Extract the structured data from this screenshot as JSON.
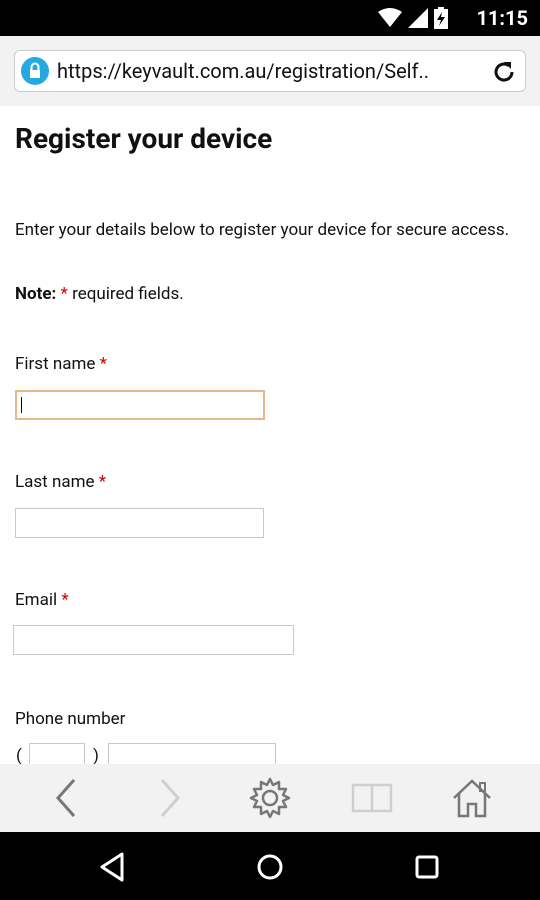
{
  "status_bar": {
    "time": "11:15",
    "icons": [
      "wifi-icon",
      "signal-icon",
      "battery-charging-icon"
    ]
  },
  "browser": {
    "url": "https://keyvault.com.au/registration/Self..",
    "lock_color": "#26a8e3"
  },
  "page": {
    "title": "Register your device",
    "intro": "Enter your details below to register your device for secure access.",
    "note_label": "Note:",
    "note_star": "*",
    "note_text": " required fields."
  },
  "form": {
    "required_marker": "*",
    "first_name_label": "First name",
    "first_name_value": "",
    "last_name_label": "Last name",
    "last_name_value": "",
    "email_label": "Email",
    "email_value": "",
    "phone_label": "Phone number",
    "phone_open_paren": "(",
    "phone_close_paren": ")",
    "phone_area_value": "",
    "phone_number_value": ""
  },
  "toolbar": {
    "buttons": [
      "back-icon",
      "forward-icon",
      "settings-icon",
      "reader-icon",
      "home-icon"
    ]
  },
  "system_nav": {
    "buttons": [
      "back-triangle-icon",
      "home-circle-icon",
      "recents-square-icon"
    ]
  }
}
